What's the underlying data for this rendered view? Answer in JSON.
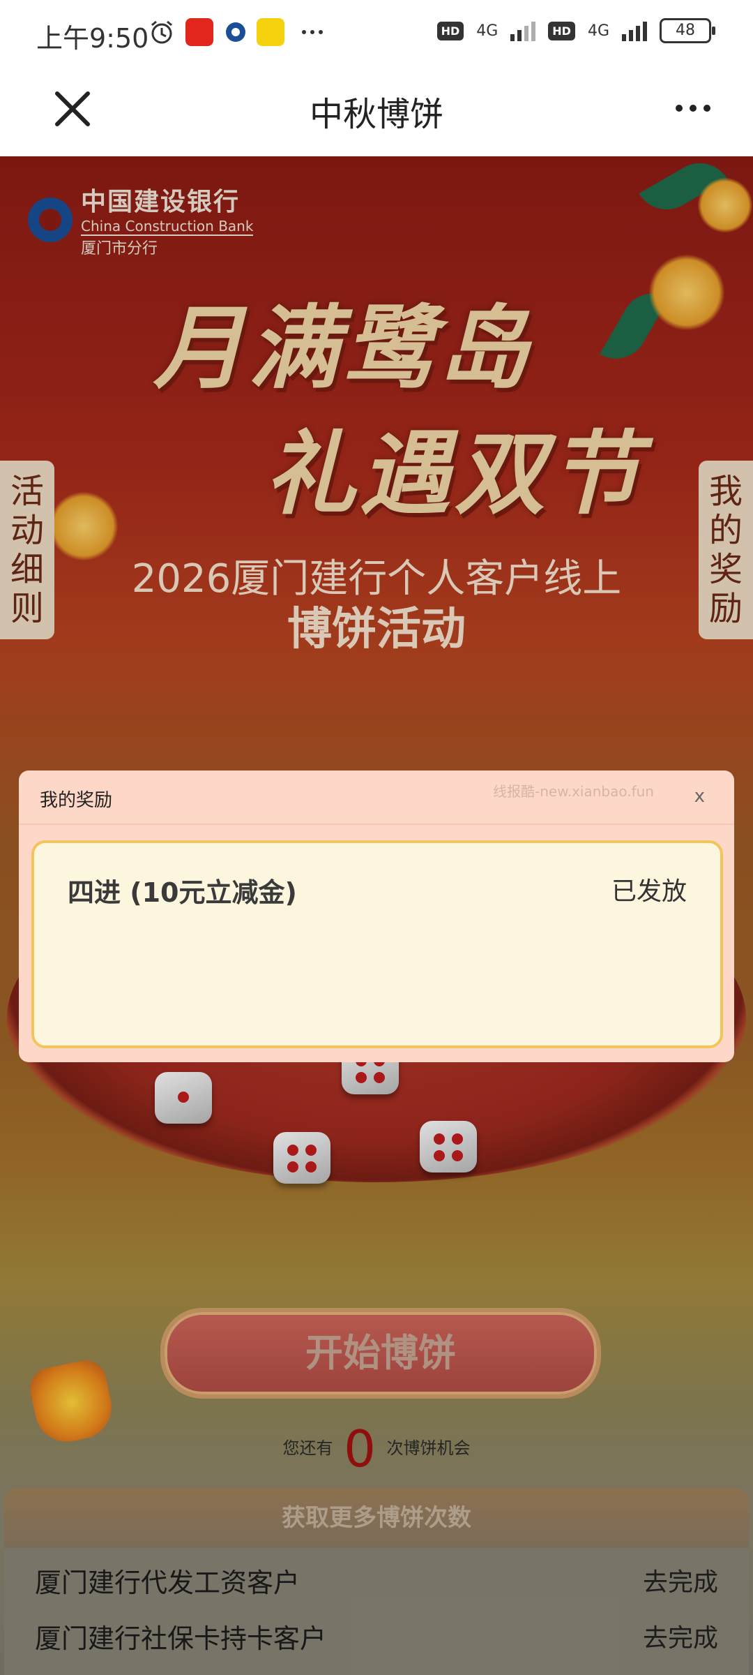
{
  "status_bar": {
    "time": "上午9:50",
    "icons": [
      "alarm-icon",
      "red-app-icon",
      "ccb-app-icon",
      "yellow-app-icon",
      "more-dots-icon"
    ],
    "network1": "4G",
    "network2": "4G",
    "hd": "HD",
    "battery": "48"
  },
  "titlebar": {
    "title": "中秋博饼",
    "close_icon": "close-icon",
    "more_icon": "more-icon"
  },
  "banner": {
    "bank_name_cn": "中国建设银行",
    "bank_name_en": "China Construction Bank",
    "branch": "厦门市分行",
    "headline_line1": "月满鹭岛",
    "headline_line2": "礼遇双节",
    "subhead_line1": "2026厦门建行个人客户线上",
    "subhead_line2": "博饼活动"
  },
  "side_tabs": {
    "left_label": "活动细则",
    "right_label": "我的奖励"
  },
  "game": {
    "start_button": "开始博饼",
    "chance_prefix": "您还有",
    "chance_count": "0",
    "chance_suffix": "次博饼机会"
  },
  "tasks": {
    "header": "获取更多博饼次数",
    "items": [
      {
        "label": "厦门建行代发工资客户",
        "action": "去完成"
      },
      {
        "label": "厦门建行社保卡持卡客户",
        "action": "去完成"
      }
    ]
  },
  "modal": {
    "title": "我的奖励",
    "watermark": "线报酷-new.xianbao.fun",
    "close": "x",
    "rewards": [
      {
        "name": "四进 (10元立减金)",
        "status": "已发放"
      }
    ]
  },
  "colors": {
    "banner_red": "#8d1c14",
    "modal_bg": "#fdd8c8",
    "card_border": "#f2c45a",
    "count_red": "#a31212"
  }
}
